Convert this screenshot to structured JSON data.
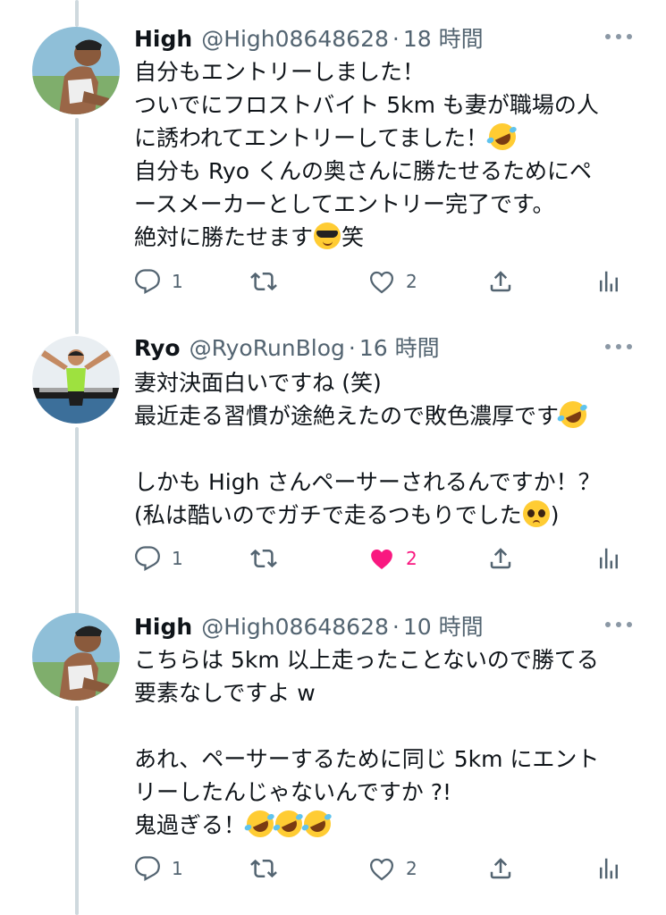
{
  "thread": [
    {
      "name": "High",
      "handle": "@High08648628",
      "dot": "·",
      "time": "18 時間",
      "lines": [
        {
          "parts": [
            {
              "t": "自分もエントリーしました！"
            }
          ]
        },
        {
          "parts": [
            {
              "t": "ついでにフロストバイト 5km も妻が職場の人"
            }
          ]
        },
        {
          "parts": [
            {
              "t": "に誘われてエントリーしてました！"
            },
            {
              "emoji": "rolling-on-floor-laughing"
            }
          ]
        },
        {
          "parts": [
            {
              "t": "自分も Ryo くんの奥さんに勝たせるためにペ"
            }
          ]
        },
        {
          "parts": [
            {
              "t": "ースメーカーとしてエントリー完了です。"
            }
          ]
        },
        {
          "parts": [
            {
              "t": "絶対に勝たせます"
            },
            {
              "emoji": "smiling-face-with-sunglasses"
            },
            {
              "t": "笑"
            }
          ]
        }
      ],
      "actions": {
        "reply_count": "1",
        "retweet_count": "",
        "like_count": "2",
        "liked": false
      }
    },
    {
      "name": "Ryo",
      "handle": "@RyoRunBlog",
      "dot": "·",
      "time": "16 時間",
      "lines": [
        {
          "parts": [
            {
              "t": "妻対決面白いですね (笑)"
            }
          ]
        },
        {
          "parts": [
            {
              "t": "最近走る習慣が途絶えたので敗色濃厚です"
            },
            {
              "emoji": "rolling-on-floor-laughing"
            }
          ]
        },
        {
          "parts": []
        },
        {
          "parts": [
            {
              "t": "しかも High さんペーサーされるんですか！？"
            }
          ]
        },
        {
          "parts": [
            {
              "t": "(私は酷いのでガチで走るつもりでした"
            },
            {
              "emoji": "pleading-face"
            },
            {
              "t": ")"
            }
          ]
        }
      ],
      "actions": {
        "reply_count": "1",
        "retweet_count": "",
        "like_count": "2",
        "liked": true
      }
    },
    {
      "name": "High",
      "handle": "@High08648628",
      "dot": "·",
      "time": "10 時間",
      "lines": [
        {
          "parts": [
            {
              "t": "こちらは 5km 以上走ったことないので勝てる"
            }
          ]
        },
        {
          "parts": [
            {
              "t": "要素なしですよ w"
            }
          ]
        },
        {
          "parts": []
        },
        {
          "parts": [
            {
              "t": "あれ、ペーサーするために同じ 5km にエント"
            }
          ]
        },
        {
          "parts": [
            {
              "t": "リーしたんじゃないんですか ?!"
            }
          ]
        },
        {
          "parts": [
            {
              "t": "鬼過ぎる！"
            },
            {
              "emoji": "rolling-on-floor-laughing"
            },
            {
              "emoji": "rolling-on-floor-laughing"
            },
            {
              "emoji": "rolling-on-floor-laughing"
            }
          ]
        }
      ],
      "actions": {
        "reply_count": "1",
        "retweet_count": "",
        "like_count": "2",
        "liked": false
      }
    }
  ],
  "icons": {
    "reply": "speech-bubble-icon",
    "retweet": "retweet-arrows-icon",
    "like": "heart-icon",
    "share": "share-upload-icon",
    "analytics": "bar-chart-icon",
    "more": "three-dots-icon"
  },
  "colors": {
    "text": "#0f1419",
    "muted": "#536471",
    "like_active": "#f91880",
    "thread_line": "#cfd9de"
  }
}
